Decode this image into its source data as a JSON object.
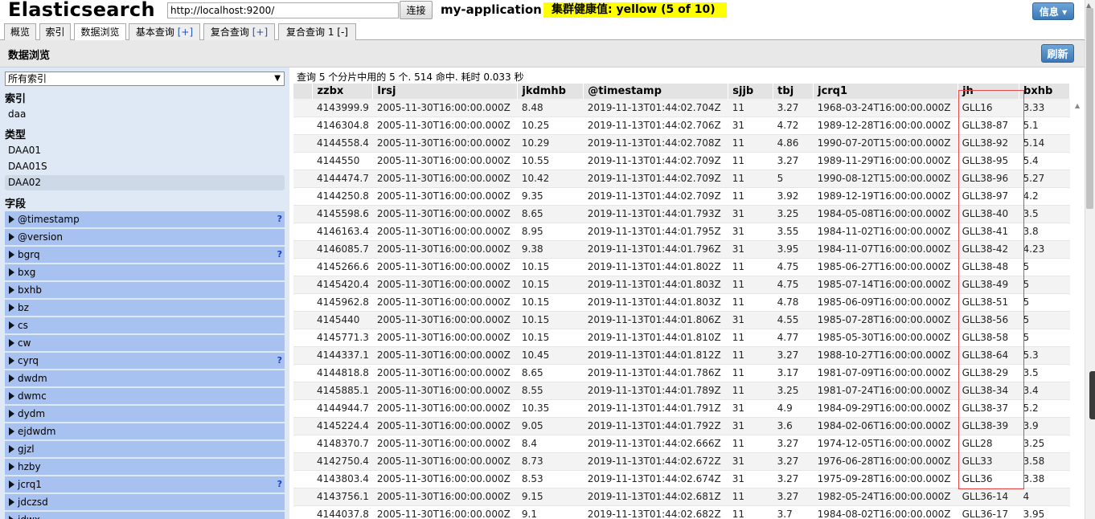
{
  "header": {
    "app_title": "Elasticsearch",
    "url_value": "http://localhost:9200/",
    "connect_label": "连接",
    "cluster_name": "my-application",
    "health": "集群健康值: yellow (5 of 10)",
    "info_label": "信息 ▾",
    "colors": {
      "health_bg": "#ffff00",
      "accent": "#3b78b6"
    }
  },
  "tabs": [
    {
      "label": "概览"
    },
    {
      "label": "索引"
    },
    {
      "label": "数据浏览",
      "active": true
    },
    {
      "label": "基本查询",
      "suffix": "[+]"
    },
    {
      "label": "复合查询",
      "suffix": "[+]"
    },
    {
      "label": "复合查询 1",
      "suffix": "[-]"
    }
  ],
  "toolbar": {
    "section_title": "数据浏览",
    "refresh_label": "刷新"
  },
  "sidebar": {
    "index_select_value": "所有索引",
    "index_heading": "索引",
    "indices": [
      "daa"
    ],
    "type_heading": "类型",
    "types": [
      "DAA01",
      "DAA01S",
      "DAA02"
    ],
    "selected_type": "DAA02",
    "field_heading": "字段",
    "fields": [
      {
        "name": "@timestamp",
        "q": "?"
      },
      {
        "name": "@version",
        "q": ""
      },
      {
        "name": "bgrq",
        "q": "?"
      },
      {
        "name": "bxg",
        "q": ""
      },
      {
        "name": "bxhb",
        "q": ""
      },
      {
        "name": "bz",
        "q": ""
      },
      {
        "name": "cs",
        "q": ""
      },
      {
        "name": "cw",
        "q": ""
      },
      {
        "name": "cyrq",
        "q": "?"
      },
      {
        "name": "dwdm",
        "q": ""
      },
      {
        "name": "dwmc",
        "q": ""
      },
      {
        "name": "dydm",
        "q": ""
      },
      {
        "name": "ejdwdm",
        "q": ""
      },
      {
        "name": "gjzl",
        "q": ""
      },
      {
        "name": "hzby",
        "q": ""
      },
      {
        "name": "jcrq1",
        "q": "?"
      },
      {
        "name": "jdczsd",
        "q": ""
      },
      {
        "name": "jdwx",
        "q": ""
      }
    ]
  },
  "results": {
    "summary": "查询 5 个分片中用的 5 个. 514 命中. 耗时 0.033 秒",
    "columns": [
      "",
      "zzbx",
      "lrsj",
      "jkdmhb",
      "@timestamp",
      "sjjb",
      "tbj",
      "jcrq1",
      "jh",
      "bxhb"
    ],
    "rows": [
      [
        "4143999.9",
        "2005-11-30T16:00:00.000Z",
        "8.48",
        "2019-11-13T01:44:02.704Z",
        "11",
        "3.27",
        "1968-03-24T16:00:00.000Z",
        "GLL16",
        "3.33"
      ],
      [
        "4146304.8",
        "2005-11-30T16:00:00.000Z",
        "10.25",
        "2019-11-13T01:44:02.706Z",
        "31",
        "4.72",
        "1989-12-28T16:00:00.000Z",
        "GLL38-87",
        "5.1"
      ],
      [
        "4144558.4",
        "2005-11-30T16:00:00.000Z",
        "10.29",
        "2019-11-13T01:44:02.708Z",
        "11",
        "4.86",
        "1990-07-20T15:00:00.000Z",
        "GLL38-92",
        "5.14"
      ],
      [
        "4144550",
        "2005-11-30T16:00:00.000Z",
        "10.55",
        "2019-11-13T01:44:02.709Z",
        "11",
        "3.27",
        "1989-11-29T16:00:00.000Z",
        "GLL38-95",
        "5.4"
      ],
      [
        "4144474.7",
        "2005-11-30T16:00:00.000Z",
        "10.42",
        "2019-11-13T01:44:02.709Z",
        "11",
        "5",
        "1990-08-12T15:00:00.000Z",
        "GLL38-96",
        "5.27"
      ],
      [
        "4144250.8",
        "2005-11-30T16:00:00.000Z",
        "9.35",
        "2019-11-13T01:44:02.709Z",
        "11",
        "3.92",
        "1989-12-19T16:00:00.000Z",
        "GLL38-97",
        "4.2"
      ],
      [
        "4145598.6",
        "2005-11-30T16:00:00.000Z",
        "8.65",
        "2019-11-13T01:44:01.793Z",
        "31",
        "3.25",
        "1984-05-08T16:00:00.000Z",
        "GLL38-40",
        "3.5"
      ],
      [
        "4146163.4",
        "2005-11-30T16:00:00.000Z",
        "8.95",
        "2019-11-13T01:44:01.795Z",
        "31",
        "3.55",
        "1984-11-02T16:00:00.000Z",
        "GLL38-41",
        "3.8"
      ],
      [
        "4146085.7",
        "2005-11-30T16:00:00.000Z",
        "9.38",
        "2019-11-13T01:44:01.796Z",
        "31",
        "3.95",
        "1984-11-07T16:00:00.000Z",
        "GLL38-42",
        "4.23"
      ],
      [
        "4145266.6",
        "2005-11-30T16:00:00.000Z",
        "10.15",
        "2019-11-13T01:44:01.802Z",
        "11",
        "4.75",
        "1985-06-27T16:00:00.000Z",
        "GLL38-48",
        "5"
      ],
      [
        "4145420.4",
        "2005-11-30T16:00:00.000Z",
        "10.15",
        "2019-11-13T01:44:01.803Z",
        "11",
        "4.75",
        "1985-07-14T16:00:00.000Z",
        "GLL38-49",
        "5"
      ],
      [
        "4145962.8",
        "2005-11-30T16:00:00.000Z",
        "10.15",
        "2019-11-13T01:44:01.803Z",
        "11",
        "4.78",
        "1985-06-09T16:00:00.000Z",
        "GLL38-51",
        "5"
      ],
      [
        "4145440",
        "2005-11-30T16:00:00.000Z",
        "10.15",
        "2019-11-13T01:44:01.806Z",
        "31",
        "4.55",
        "1985-07-28T16:00:00.000Z",
        "GLL38-56",
        "5"
      ],
      [
        "4145771.3",
        "2005-11-30T16:00:00.000Z",
        "10.15",
        "2019-11-13T01:44:01.810Z",
        "11",
        "4.77",
        "1985-05-30T16:00:00.000Z",
        "GLL38-58",
        "5"
      ],
      [
        "4144337.1",
        "2005-11-30T16:00:00.000Z",
        "10.45",
        "2019-11-13T01:44:01.812Z",
        "11",
        "3.27",
        "1988-10-27T16:00:00.000Z",
        "GLL38-64",
        "5.3"
      ],
      [
        "4144818.8",
        "2005-11-30T16:00:00.000Z",
        "8.65",
        "2019-11-13T01:44:01.786Z",
        "11",
        "3.17",
        "1981-07-09T16:00:00.000Z",
        "GLL38-29",
        "3.5"
      ],
      [
        "4145885.1",
        "2005-11-30T16:00:00.000Z",
        "8.55",
        "2019-11-13T01:44:01.789Z",
        "11",
        "3.25",
        "1981-07-24T16:00:00.000Z",
        "GLL38-34",
        "3.4"
      ],
      [
        "4144944.7",
        "2005-11-30T16:00:00.000Z",
        "10.35",
        "2019-11-13T01:44:01.791Z",
        "31",
        "4.9",
        "1984-09-29T16:00:00.000Z",
        "GLL38-37",
        "5.2"
      ],
      [
        "4145224.4",
        "2005-11-30T16:00:00.000Z",
        "9.05",
        "2019-11-13T01:44:01.792Z",
        "31",
        "3.6",
        "1984-02-06T16:00:00.000Z",
        "GLL38-39",
        "3.9"
      ],
      [
        "4148370.7",
        "2005-11-30T16:00:00.000Z",
        "8.4",
        "2019-11-13T01:44:02.666Z",
        "11",
        "3.27",
        "1974-12-05T16:00:00.000Z",
        "GLL28",
        "3.25"
      ],
      [
        "4142750.4",
        "2005-11-30T16:00:00.000Z",
        "8.73",
        "2019-11-13T01:44:02.672Z",
        "31",
        "3.27",
        "1976-06-28T16:00:00.000Z",
        "GLL33",
        "3.58"
      ],
      [
        "4143803.4",
        "2005-11-30T16:00:00.000Z",
        "8.53",
        "2019-11-13T01:44:02.674Z",
        "31",
        "3.27",
        "1975-09-28T16:00:00.000Z",
        "GLL36",
        "3.38"
      ],
      [
        "4143756.1",
        "2005-11-30T16:00:00.000Z",
        "9.15",
        "2019-11-13T01:44:02.681Z",
        "11",
        "3.27",
        "1982-05-24T16:00:00.000Z",
        "GLL36-14",
        "4"
      ],
      [
        "4144037.8",
        "2005-11-30T16:00:00.000Z",
        "9.1",
        "2019-11-13T01:44:02.682Z",
        "11",
        "3.7",
        "1984-08-02T16:00:00.000Z",
        "GLL36-17",
        "3.95"
      ]
    ]
  }
}
